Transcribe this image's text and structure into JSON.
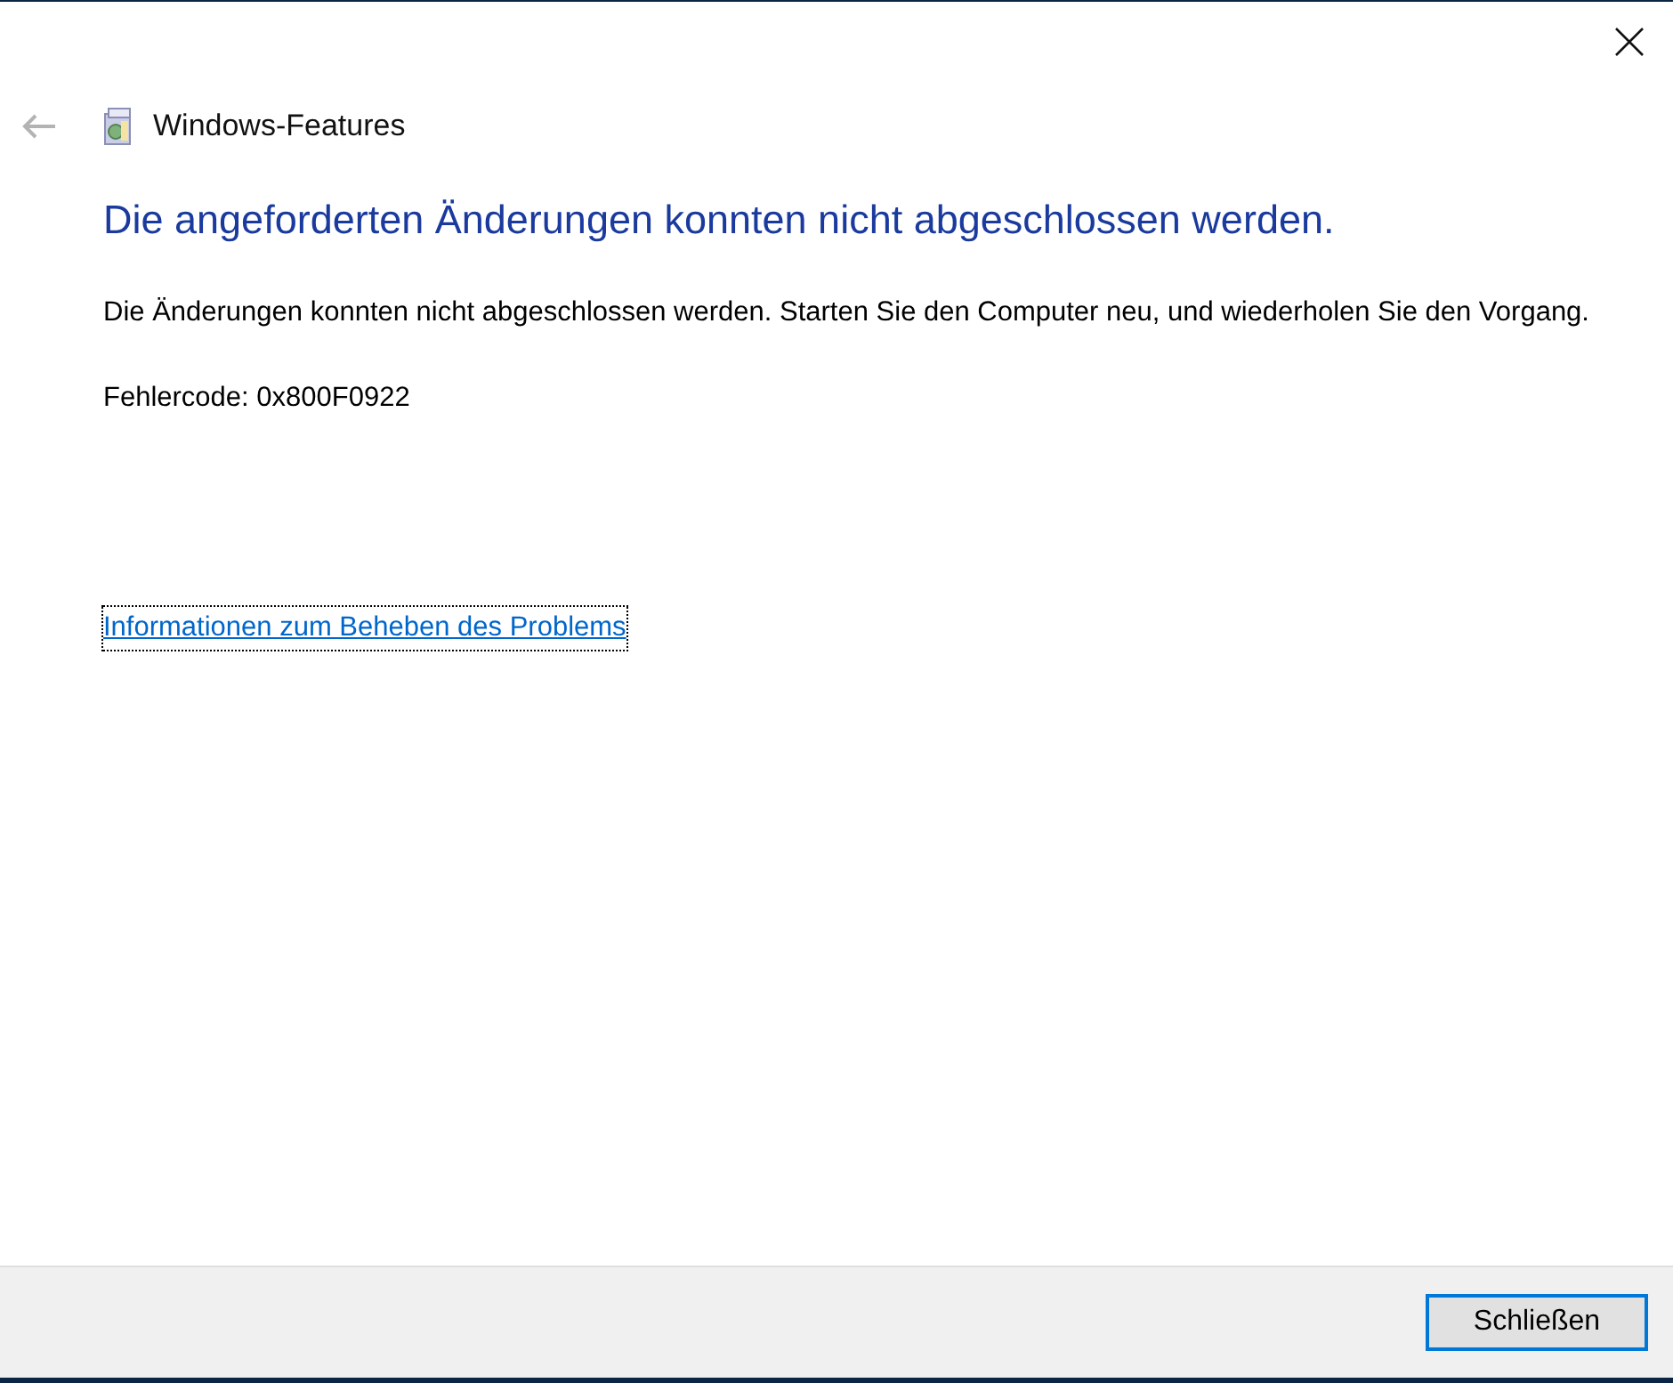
{
  "window": {
    "title": "Windows-Features"
  },
  "heading": "Die angeforderten Änderungen konnten nicht abgeschlossen werden.",
  "message": "Die Änderungen konnten nicht abgeschlossen werden. Starten Sie den Computer neu, und wiederholen Sie den Vorgang.",
  "error_code": "Fehlercode: 0x800F0922",
  "help_link": "Informationen zum Beheben des Problems",
  "buttons": [
    {
      "label": "Schließen",
      "selected": true
    }
  ]
}
